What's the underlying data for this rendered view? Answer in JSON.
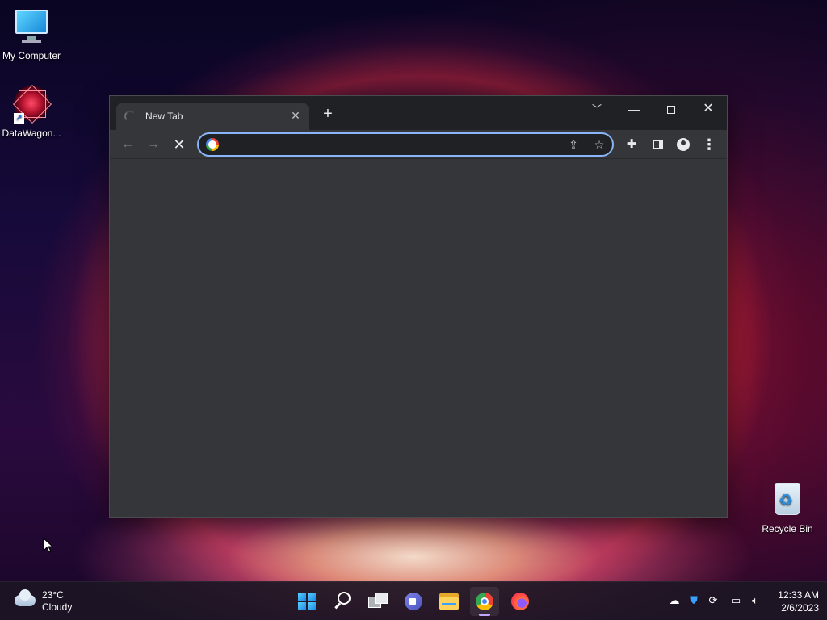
{
  "desktop": {
    "icons": [
      {
        "label": "My Computer",
        "icon": "monitor-icon"
      },
      {
        "label": "DataWagon...",
        "icon": "datawagon-icon"
      },
      {
        "label": "Recycle Bin",
        "icon": "recycle-bin-icon"
      }
    ]
  },
  "browser": {
    "tab": {
      "title": "New Tab"
    },
    "omnibox": {
      "value": "",
      "placeholder": ""
    },
    "icons": {
      "back": "arrow-left-icon",
      "forward": "arrow-right-icon",
      "stop": "close-icon",
      "share": "share-icon",
      "bookmark": "star-icon",
      "extensions": "puzzle-icon",
      "side_panel": "side-panel-icon",
      "profile": "person-icon",
      "menu": "kebab-menu-icon"
    },
    "colors": {
      "frame": "#202124",
      "toolbar": "#35363a",
      "focus_ring": "#8ab4f8"
    }
  },
  "taskbar": {
    "weather": {
      "temp": "23°C",
      "condition": "Cloudy"
    },
    "apps": [
      {
        "name": "start",
        "icon": "windows-logo-icon"
      },
      {
        "name": "search",
        "icon": "search-icon"
      },
      {
        "name": "task-view",
        "icon": "task-view-icon"
      },
      {
        "name": "teams-chat",
        "icon": "video-chat-icon"
      },
      {
        "name": "file-explorer",
        "icon": "folder-icon"
      },
      {
        "name": "chrome",
        "icon": "chrome-icon",
        "active": true
      },
      {
        "name": "firefox",
        "icon": "firefox-icon"
      }
    ],
    "tray": {
      "icons": [
        "cloud-offline-icon",
        "security-shield-icon",
        "sync-icon",
        "network-icon",
        "speaker-icon"
      ]
    },
    "clock": {
      "time": "12:33 AM",
      "date": "2/6/2023"
    }
  }
}
